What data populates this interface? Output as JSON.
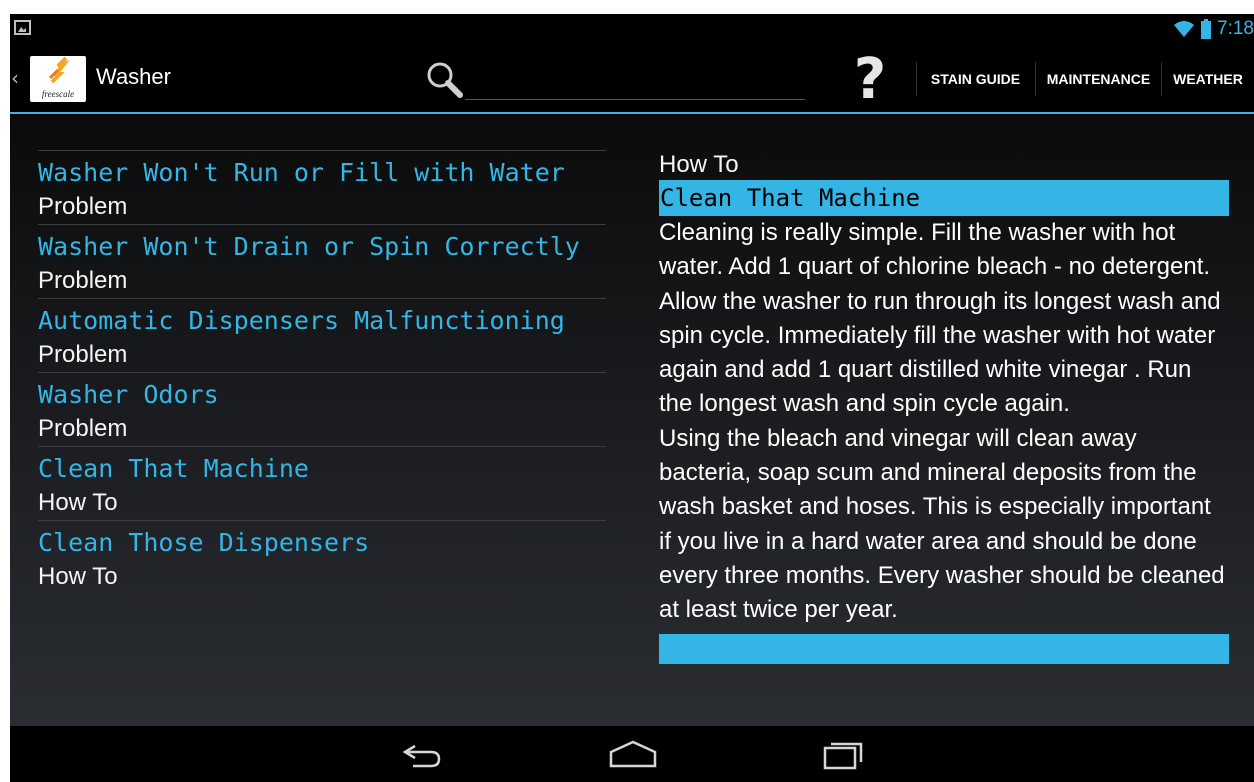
{
  "status_bar": {
    "time": "7:18"
  },
  "action_bar": {
    "logo_text": "freescale",
    "title": "Washer",
    "search_value": "",
    "tabs": [
      "STAIN GUIDE",
      "MAINTENANCE",
      "WEATHER"
    ]
  },
  "topics": [
    {
      "title": "Washer Won't Run or Fill with Water",
      "type": "Problem"
    },
    {
      "title": "Washer Won't Drain or Spin Correctly",
      "type": "Problem"
    },
    {
      "title": "Automatic Dispensers Malfunctioning",
      "type": "Problem"
    },
    {
      "title": "Washer Odors",
      "type": "Problem"
    },
    {
      "title": "Clean That Machine",
      "type": "How To"
    },
    {
      "title": "Clean Those Dispensers",
      "type": "How To"
    }
  ],
  "detail": {
    "type": "How To",
    "title": "Clean That Machine",
    "body": "Cleaning is really simple. Fill the washer with hot water. Add 1 quart of chlorine bleach - no detergent. Allow the washer to run through its longest wash and spin cycle. Immediately fill the washer with hot water again and add 1 quart distilled white vinegar . Run the longest wash and spin cycle again.\nUsing the bleach and vinegar will clean away bacteria, soap scum and mineral deposits from the wash basket and hoses. This is especially important if you live in a hard water area and should be done every three months. Every washer should be cleaned at least twice per year."
  },
  "colors": {
    "accent": "#33b5e5",
    "background": "#000000"
  }
}
